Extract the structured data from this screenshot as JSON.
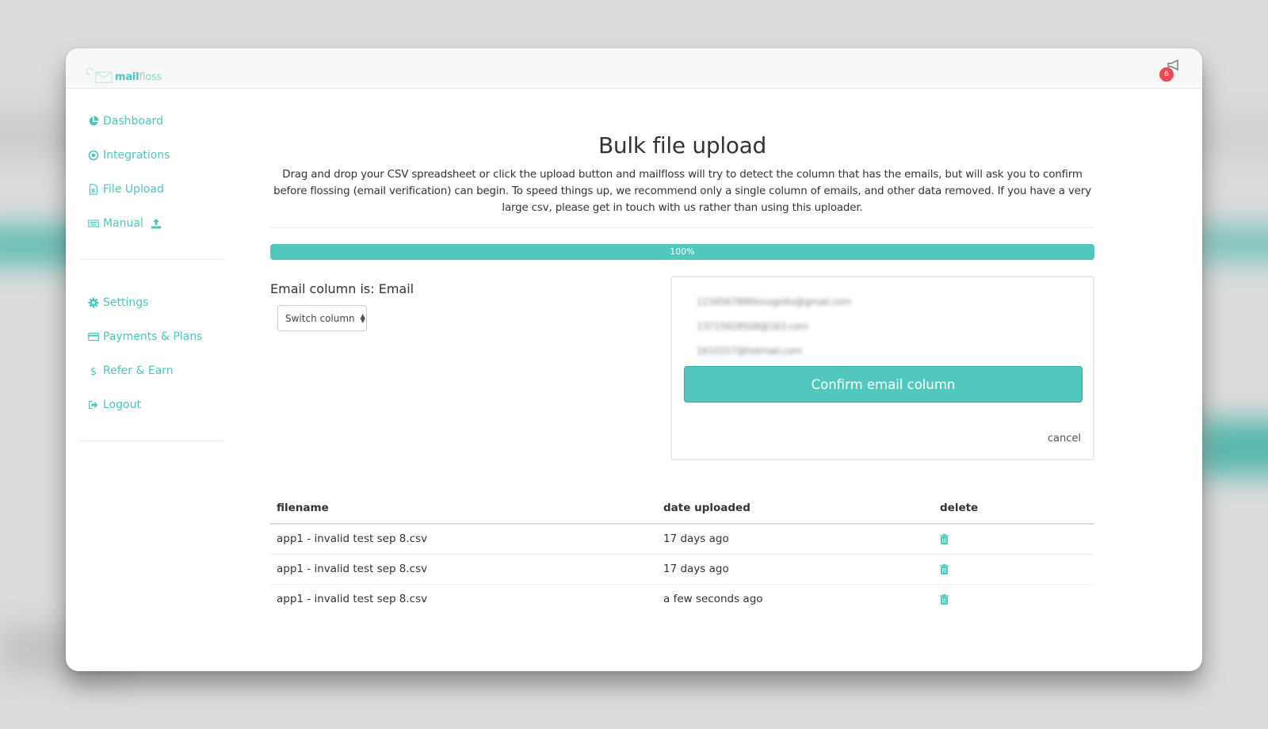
{
  "app": {
    "brand_prefix": "mail",
    "brand_suffix": "floss",
    "notification_count": "6",
    "accent_color": "#52c7be",
    "badge_color": "#ee4a55"
  },
  "sidebar": {
    "primary": [
      {
        "label": "Dashboard",
        "icon": "pie-chart-icon"
      },
      {
        "label": "Integrations",
        "icon": "target-icon"
      },
      {
        "label": "File Upload",
        "icon": "excel-file-icon"
      },
      {
        "label": "Manual",
        "icon": "keyboard-icon",
        "trail_icon": "upload-icon"
      }
    ],
    "secondary": [
      {
        "label": "Settings",
        "icon": "gear-icon"
      },
      {
        "label": "Payments & Plans",
        "icon": "credit-card-icon"
      },
      {
        "label": "Refer & Earn",
        "icon": "dollar-icon"
      },
      {
        "label": "Logout",
        "icon": "sign-out-icon"
      }
    ]
  },
  "main": {
    "title": "Bulk file upload",
    "intro": "Drag and drop your CSV spreadsheet or click the upload button and mailfloss will try to detect the column that has the emails, but will ask you to confirm before flossing (email verification) can begin. To speed things up, we recommend only a single column of emails, and other data removed. If you have a very large csv, please get in touch with us rather than using this uploader.",
    "progress": {
      "percent": 100,
      "label": "100%"
    },
    "email_column_label": "Email column is: Email",
    "switch_select": {
      "selected": "Switch column"
    },
    "preview_emails": [
      "1234567890incognito@gmail.com",
      "13715928508@163.com",
      "1610157@hotmail.com"
    ],
    "confirm_button": "Confirm email column",
    "cancel_link": "cancel"
  },
  "files_table": {
    "columns": [
      "filename",
      "date uploaded",
      "delete"
    ],
    "rows": [
      {
        "filename": "app1 - invalid test sep 8.csv",
        "date": "17 days ago"
      },
      {
        "filename": "app1 - invalid test sep 8.csv",
        "date": "17 days ago"
      },
      {
        "filename": "app1 - invalid test sep 8.csv",
        "date": "a few seconds ago"
      }
    ]
  }
}
